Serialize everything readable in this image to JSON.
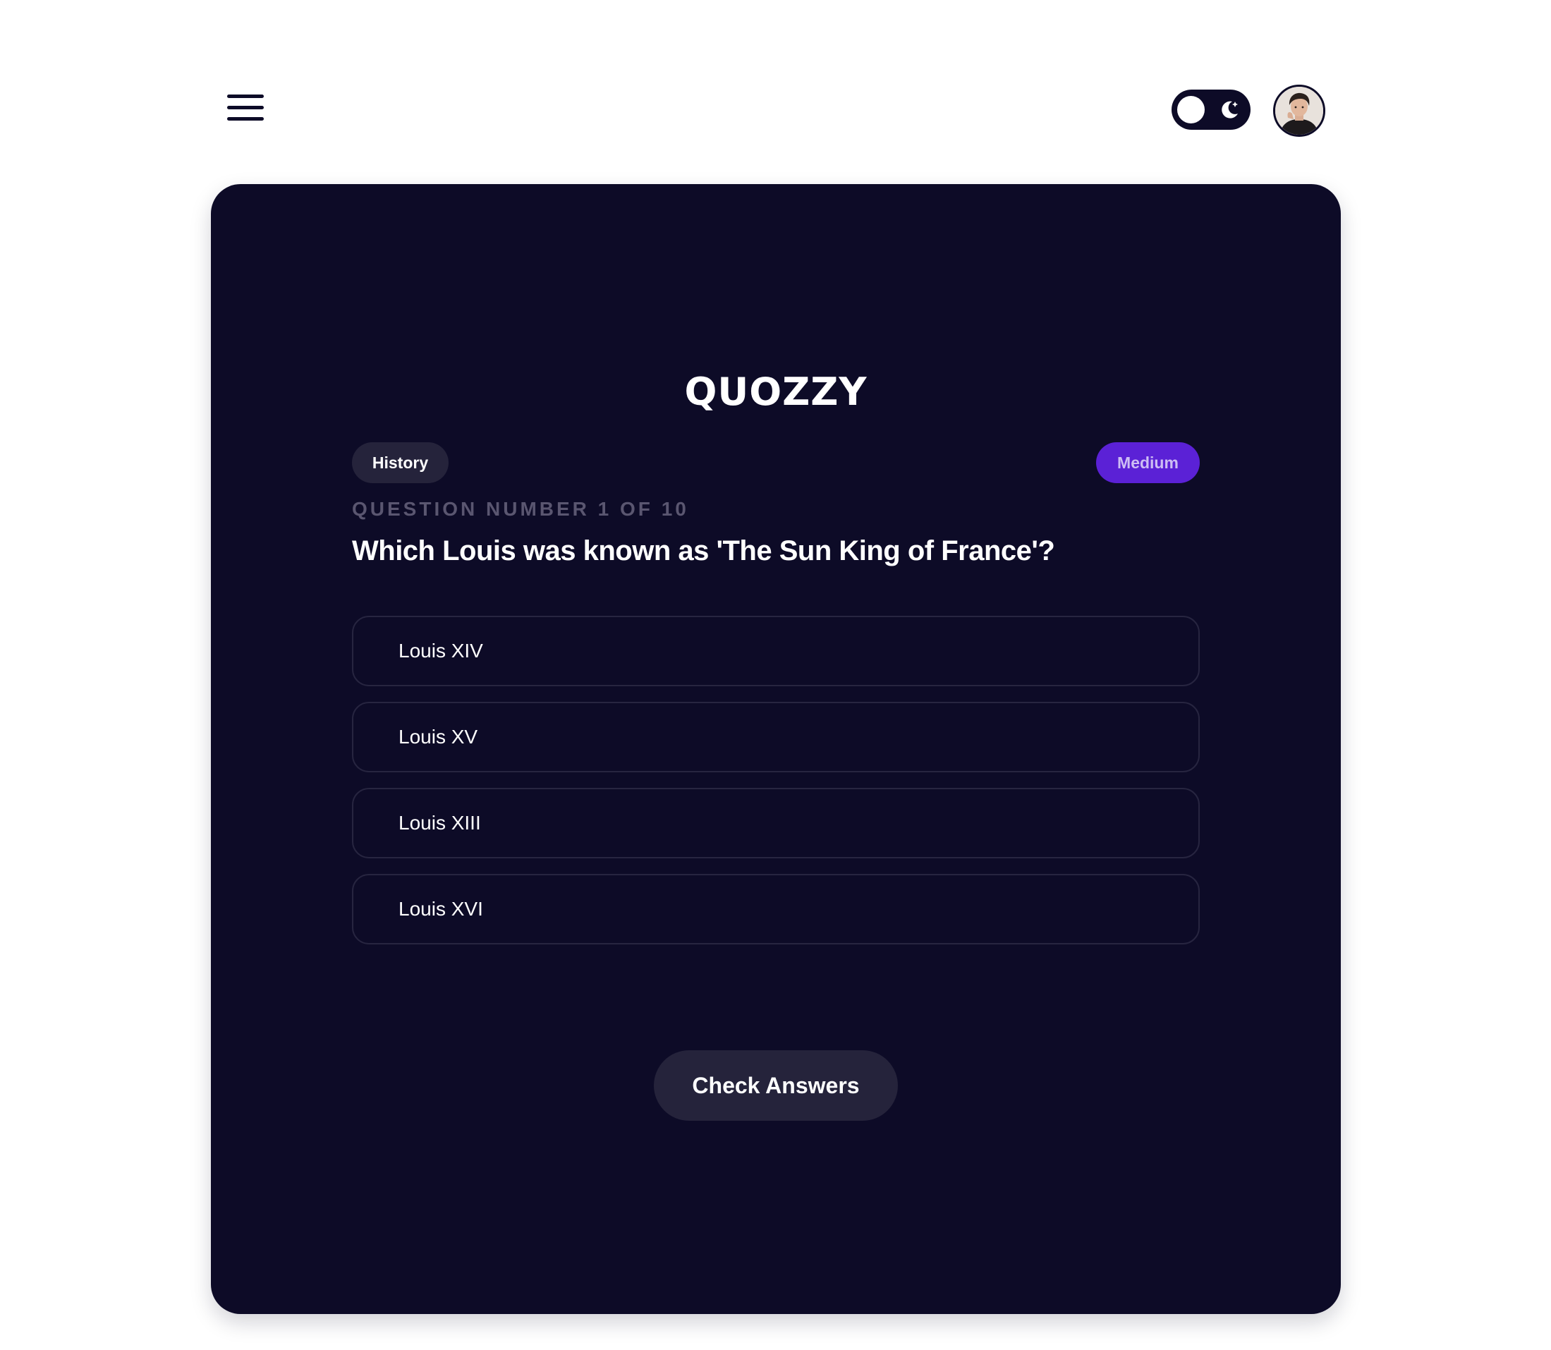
{
  "header": {
    "menu_icon": "hamburger-menu-icon",
    "theme_toggle": {
      "state": "dark",
      "knob_icon": "sun-circle-icon",
      "icon": "moon-star-icon"
    },
    "avatar_icon": "user-avatar"
  },
  "quiz": {
    "brand": "QUOZZY",
    "category": "History",
    "difficulty": "Medium",
    "counter": "QUESTION NUMBER 1 OF 10",
    "question": "Which Louis was known as 'The Sun King of France'?",
    "options": [
      {
        "label": "Louis XIV"
      },
      {
        "label": "Louis XV"
      },
      {
        "label": "Louis XIII"
      },
      {
        "label": "Louis XVI"
      }
    ],
    "submit_label": "Check Answers"
  },
  "colors": {
    "background": "#ffffff",
    "card": "#0d0b27",
    "accent": "#5b21d6",
    "chip": "#25233b",
    "option_border": "#272540",
    "muted_text": "#5a5670"
  }
}
